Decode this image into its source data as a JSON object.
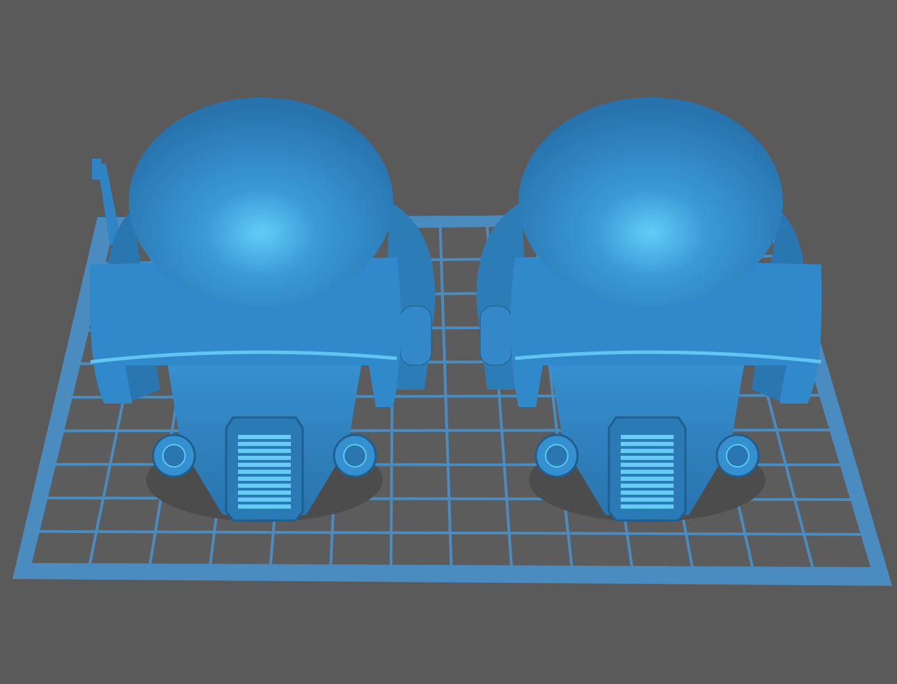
{
  "viewport": {
    "background_color": "#5a5a5a",
    "bed_color": "#4a8bc0",
    "grid_line_color": "#4a8bc0",
    "bed_surface_color": "#5c5c5c",
    "model_color": "#2f84c4",
    "model_highlight_color": "#5cc8f5",
    "model_shadow_color": "#1f5e8e"
  },
  "models": [
    {
      "name": "helmet-left",
      "has_antenna": true
    },
    {
      "name": "helmet-right",
      "has_antenna": false
    }
  ]
}
